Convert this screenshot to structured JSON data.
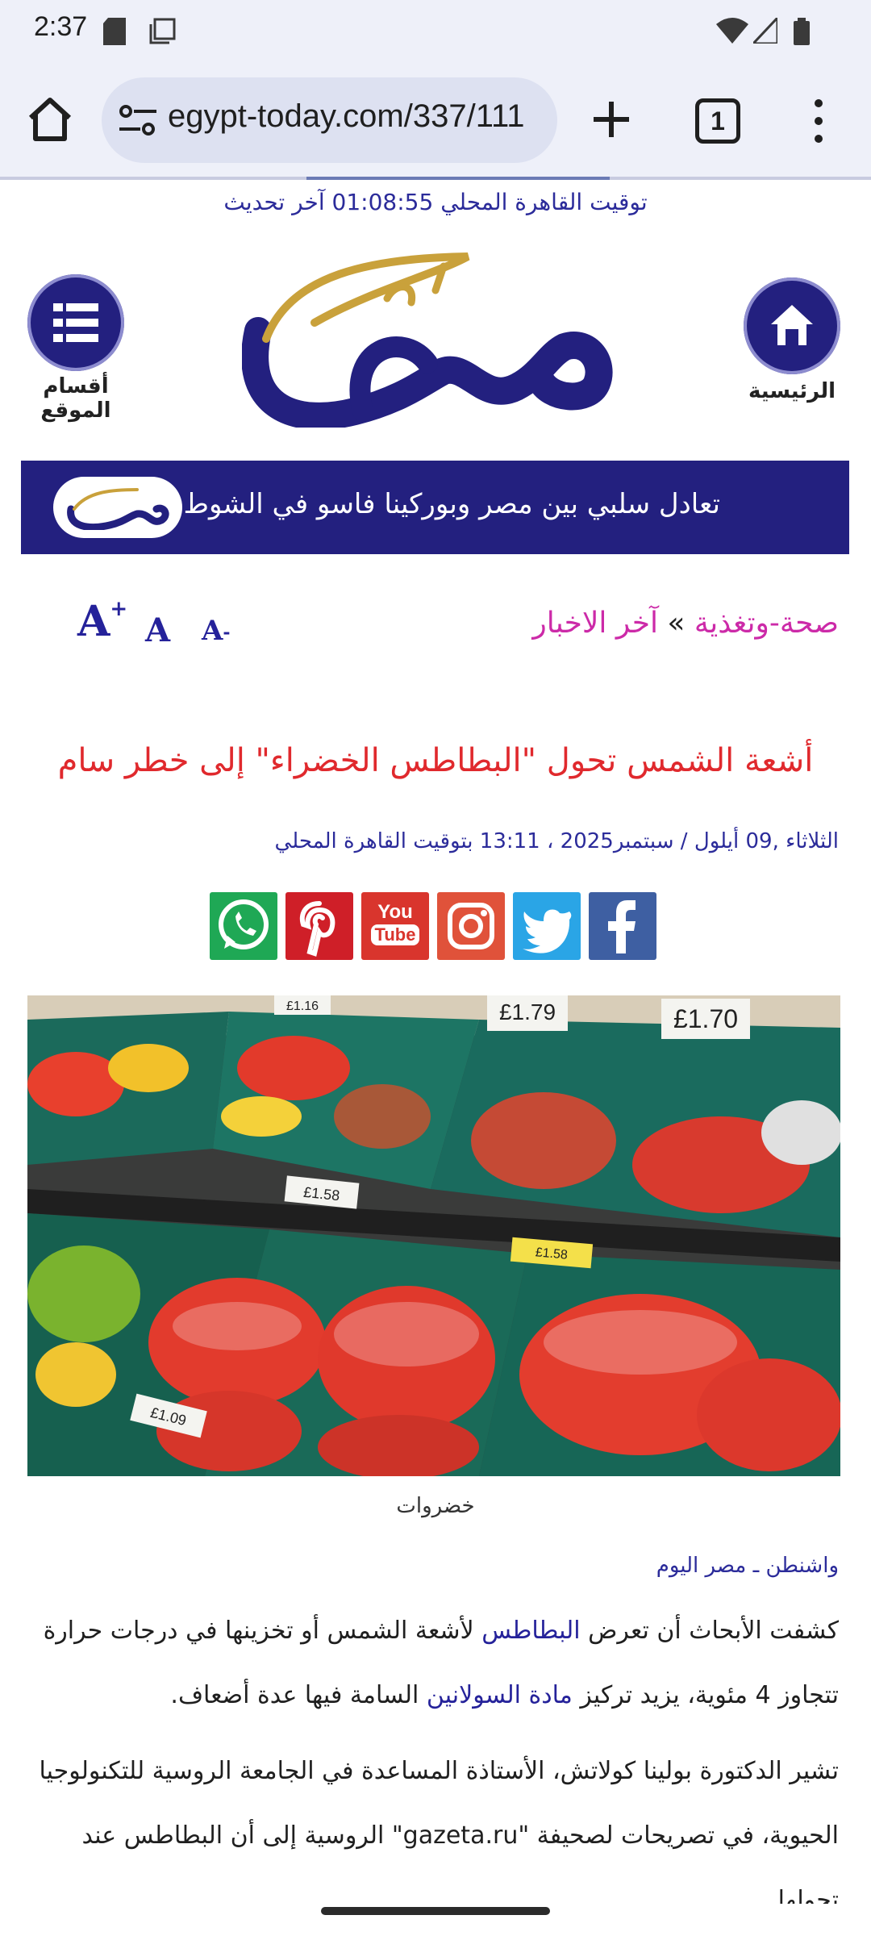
{
  "status_bar": {
    "time": "2:37",
    "icons": [
      "sd-card-icon",
      "screenshot-icon",
      "wifi-icon",
      "signal-icon",
      "battery-icon"
    ]
  },
  "browser": {
    "url": "egypt-today.com/337/111",
    "tab_count": "1",
    "page_load_progress": 0.7
  },
  "header": {
    "local_time": "توقيت القاهرة المحلي 01:08:55 آخر تحديث",
    "home_label": "الرئيسية",
    "menu_label": "أقسام الموقع"
  },
  "ticker": {
    "text": "تعادل سلبي بين مصر وبوركينا فاسو في الشوط الأول"
  },
  "breadcrumb": {
    "section": "صحة-وتغذية",
    "separator": "»",
    "latest": "آخر الاخبار"
  },
  "font_controls": {
    "large": "A",
    "large_sign": "+",
    "medium": "A",
    "small": "A",
    "small_sign": "-"
  },
  "article": {
    "headline": "أشعة الشمس تحول \"البطاطس الخضراء\" إلى خطر سام",
    "dateline": "الثلاثاء ,09 أيلول / سبتمبر2025 ، 13:11 بتوقيت القاهرة المحلي",
    "image_caption": "خضروات",
    "source": "واشنطن ـ مصر اليوم",
    "p1_a": "كشفت الأبحاث أن تعرض ",
    "p1_link1": "البطاطس",
    "p1_b": " لأشعة الشمس أو تخزينها في درجات حرارة تتجاوز 4 مئوية، يزيد تركيز ",
    "p1_link2": "مادة السولانين",
    "p1_c": " السامة فيها عدة أضعاف.",
    "p2": "تشير الدكتورة بولينا كولاتش، الأستاذة المساعدة في الجامعة الروسية للتكنولوجيا الحيوية، في تصريحات لصحيفة \"gazeta.ru\" الروسية إلى أن البطاطس عند تحولها"
  },
  "photo": {
    "price_tags": [
      "£1.16",
      "£1.79",
      "£1.70",
      "£1.58",
      "£1.58",
      "£1.09"
    ]
  },
  "social": {
    "icons": [
      "whatsapp-icon",
      "pinterest-icon",
      "youtube-icon",
      "instagram-icon",
      "twitter-icon",
      "facebook-icon"
    ],
    "youtube_text_top": "You",
    "youtube_text_bottom": "Tube",
    "colors": {
      "whatsapp": "#1fa855",
      "pinterest": "#cf1f28",
      "youtube": "#d9352d",
      "instagram": "#e0523a",
      "twitter": "#2aa5e6",
      "facebook": "#3e5fa2"
    }
  },
  "colors": {
    "brand_navy": "#23207f",
    "headline_red": "#e0292d",
    "breadcrumb_magenta": "#cc2aa8",
    "logo_gold": "#c9a13b"
  }
}
